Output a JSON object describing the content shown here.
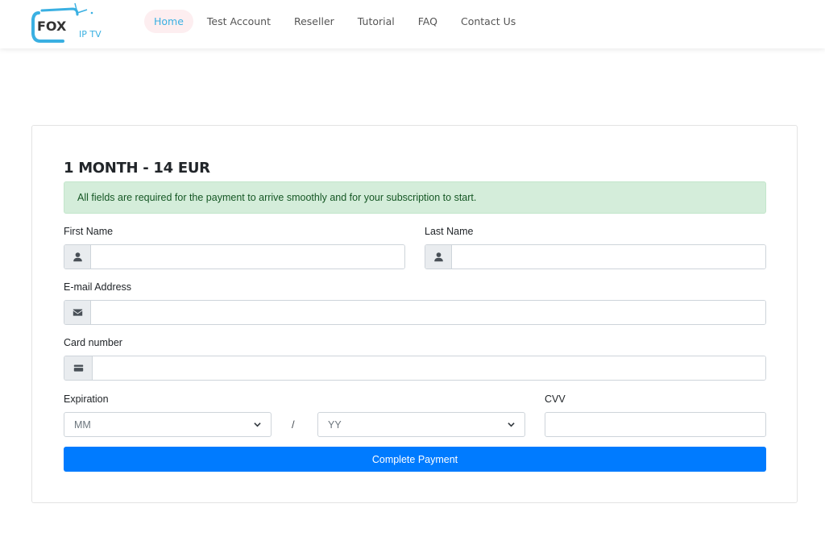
{
  "header": {
    "logo": {
      "text_main": "FOX",
      "text_sub": "IP TV",
      "accent_color": "#3ab0e2"
    },
    "nav": [
      {
        "label": "Home",
        "active": true
      },
      {
        "label": "Test Account",
        "active": false
      },
      {
        "label": "Reseller",
        "active": false
      },
      {
        "label": "Tutorial",
        "active": false
      },
      {
        "label": "FAQ",
        "active": false
      },
      {
        "label": "Contact Us",
        "active": false
      }
    ]
  },
  "form": {
    "title": "1 MONTH - 14 EUR",
    "alert": "All fields are required for the payment to arrive smoothly and for your subscription to start.",
    "first_name": {
      "label": "First Name",
      "value": "",
      "icon": "user-icon"
    },
    "last_name": {
      "label": "Last Name",
      "value": "",
      "icon": "user-icon"
    },
    "email": {
      "label": "E-mail Address",
      "value": "",
      "icon": "envelope-icon"
    },
    "card_number": {
      "label": "Card number",
      "value": "",
      "icon": "credit-card-icon"
    },
    "expiration": {
      "label": "Expiration",
      "month_selected": "MM",
      "separator": "/",
      "year_selected": "YY"
    },
    "cvv": {
      "label": "CVV",
      "value": ""
    },
    "submit_label": "Complete Payment",
    "colors": {
      "primary": "#007bff",
      "alert_bg": "#d4edda",
      "alert_text": "#155724"
    }
  }
}
